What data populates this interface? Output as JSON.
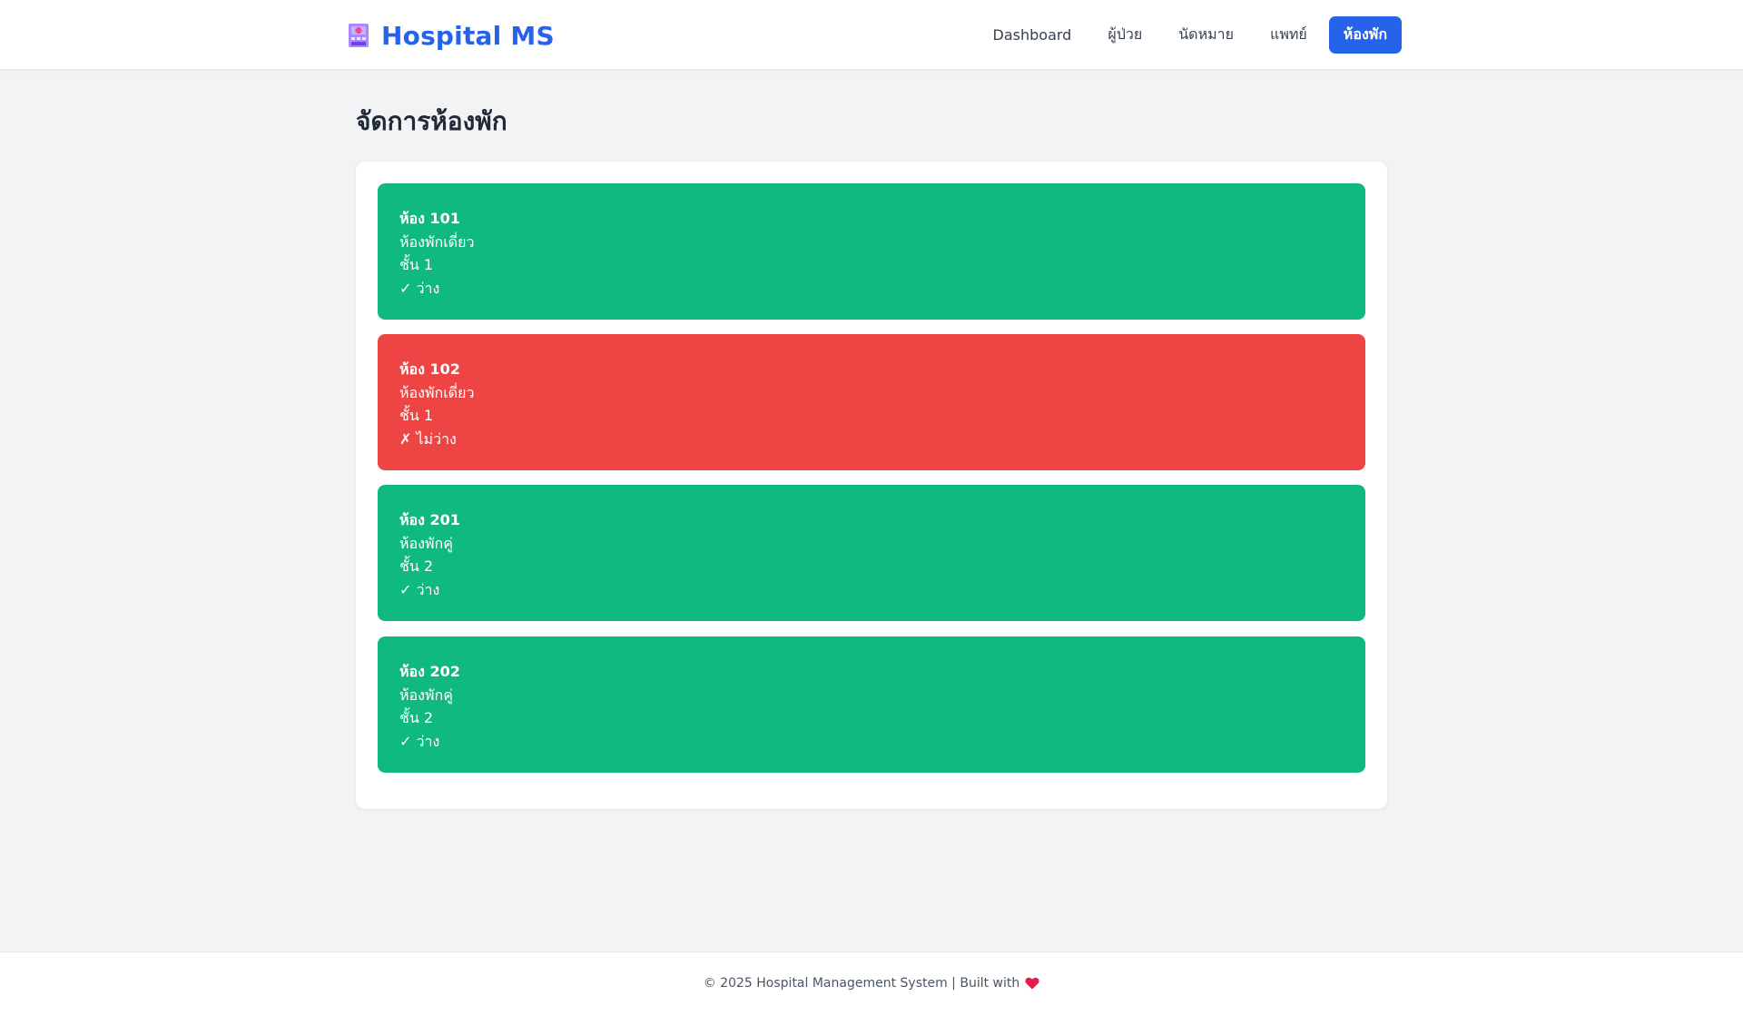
{
  "brand": {
    "title": "Hospital MS",
    "icon": "hospital-icon"
  },
  "nav": [
    {
      "label": "Dashboard",
      "active": false
    },
    {
      "label": "ผู้ป่วย",
      "active": false
    },
    {
      "label": "นัดหมาย",
      "active": false
    },
    {
      "label": "แพทย์",
      "active": false
    },
    {
      "label": "ห้องพัก",
      "active": true
    }
  ],
  "main": {
    "title": "จัดการห้องพัก",
    "rooms": [
      {
        "name": "ห้อง 101",
        "type": "ห้องพักเดี่ยว",
        "floor": "ชั้น 1",
        "status": "✓ ว่าง",
        "available": true
      },
      {
        "name": "ห้อง 102",
        "type": "ห้องพักเดี่ยว",
        "floor": "ชั้น 1",
        "status": "✗ ไม่ว่าง",
        "available": false
      },
      {
        "name": "ห้อง 201",
        "type": "ห้องพักคู่",
        "floor": "ชั้น 2",
        "status": "✓ ว่าง",
        "available": true
      },
      {
        "name": "ห้อง 202",
        "type": "ห้องพักคู่",
        "floor": "ชั้น 2",
        "status": "✓ ว่าง",
        "available": true
      }
    ]
  },
  "footer": {
    "text": "© 2025 Hospital Management System | Built with",
    "icon": "heart-icon"
  },
  "colors": {
    "accent": "#2563eb",
    "available": "#10b981",
    "unavailable": "#ef4444",
    "background": "#f2f3f5"
  }
}
